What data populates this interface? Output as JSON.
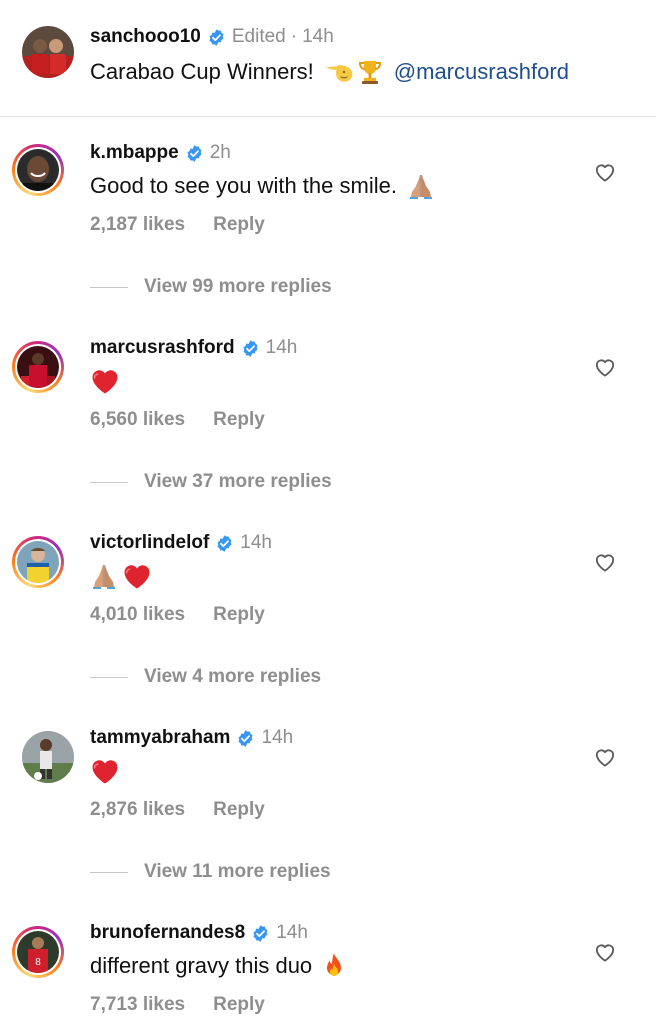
{
  "post": {
    "username": "sanchooo10",
    "edited_label": "Edited",
    "time": "14h",
    "caption_text": "Carabao Cup Winners!",
    "caption_emojis": [
      "backhand-pointing-icon",
      "trophy-icon"
    ],
    "mention": "@marcusrashford"
  },
  "comments": [
    {
      "username": "k.mbappe",
      "time": "2h",
      "text": "Good to see you with the smile.",
      "emojis": [
        "folded-hands-icon"
      ],
      "likes": "2,187 likes",
      "reply": "Reply",
      "view_replies": "View 99 more replies",
      "avatar_ring": true
    },
    {
      "username": "marcusrashford",
      "time": "14h",
      "text": "",
      "emojis": [
        "red-heart-icon"
      ],
      "likes": "6,560 likes",
      "reply": "Reply",
      "view_replies": "View 37 more replies",
      "avatar_ring": true
    },
    {
      "username": "victorlindelof",
      "time": "14h",
      "text": "",
      "emojis": [
        "folded-hands-icon",
        "red-heart-icon"
      ],
      "likes": "4,010 likes",
      "reply": "Reply",
      "view_replies": "View 4 more replies",
      "avatar_ring": true
    },
    {
      "username": "tammyabraham",
      "time": "14h",
      "text": "",
      "emojis": [
        "red-heart-icon"
      ],
      "likes": "2,876 likes",
      "reply": "Reply",
      "view_replies": "View 11 more replies",
      "avatar_ring": false
    },
    {
      "username": "brunofernandes8",
      "time": "14h",
      "text": "different gravy this duo",
      "emojis": [
        "fire-icon"
      ],
      "likes": "7,713 likes",
      "reply": "Reply",
      "avatar_ring": true
    }
  ],
  "colors": {
    "verified_blue": "#3897f0",
    "mention_blue": "#1f4e8c",
    "meta_gray": "#8e8e8e"
  }
}
